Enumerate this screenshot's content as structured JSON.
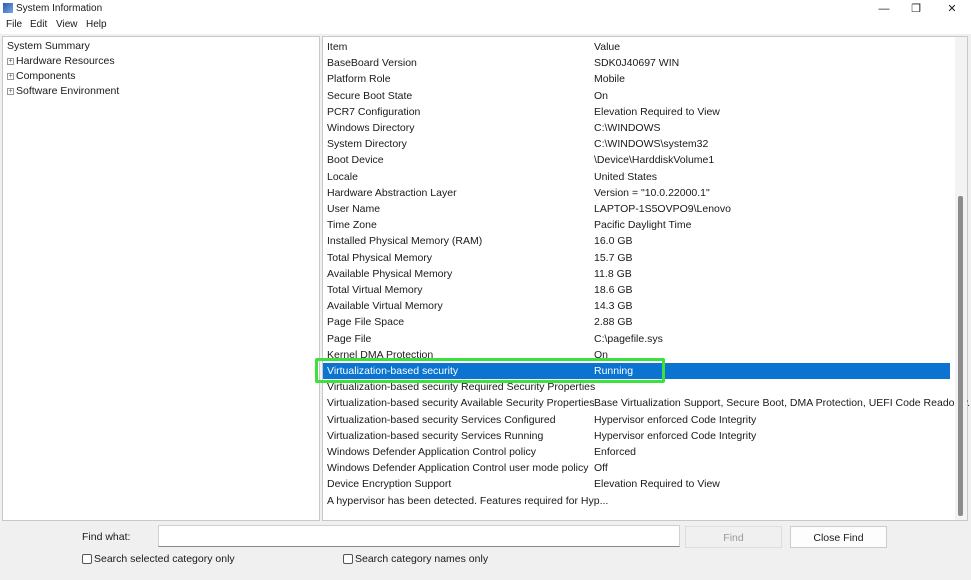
{
  "window": {
    "title": "System Information",
    "minimize": "—",
    "restore": "❐",
    "close": "✕"
  },
  "menu": [
    "File",
    "Edit",
    "View",
    "Help"
  ],
  "tree": {
    "root": "System Summary",
    "children": [
      "Hardware Resources",
      "Components",
      "Software Environment"
    ],
    "expand_glyph": "+"
  },
  "table": {
    "headers": [
      "Item",
      "Value"
    ],
    "rows": [
      [
        "BaseBoard Version",
        "SDK0J40697 WIN"
      ],
      [
        "Platform Role",
        "Mobile"
      ],
      [
        "Secure Boot State",
        "On"
      ],
      [
        "PCR7 Configuration",
        "Elevation Required to View"
      ],
      [
        "Windows Directory",
        "C:\\WINDOWS"
      ],
      [
        "System Directory",
        "C:\\WINDOWS\\system32"
      ],
      [
        "Boot Device",
        "\\Device\\HarddiskVolume1"
      ],
      [
        "Locale",
        "United States"
      ],
      [
        "Hardware Abstraction Layer",
        "Version = \"10.0.22000.1\""
      ],
      [
        "User Name",
        "LAPTOP-1S5OVPO9\\Lenovo"
      ],
      [
        "Time Zone",
        "Pacific Daylight Time"
      ],
      [
        "Installed Physical Memory (RAM)",
        "16.0 GB"
      ],
      [
        "Total Physical Memory",
        "15.7 GB"
      ],
      [
        "Available Physical Memory",
        "11.8 GB"
      ],
      [
        "Total Virtual Memory",
        "18.6 GB"
      ],
      [
        "Available Virtual Memory",
        "14.3 GB"
      ],
      [
        "Page File Space",
        "2.88 GB"
      ],
      [
        "Page File",
        "C:\\pagefile.sys"
      ],
      [
        "Kernel DMA Protection",
        "On"
      ],
      [
        "Virtualization-based security",
        "Running"
      ],
      [
        "Virtualization-based security Required Security Properties",
        ""
      ],
      [
        "Virtualization-based security Available Security Properties",
        "Base Virtualization Support, Secure Boot, DMA Protection, UEFI Code Readonly..."
      ],
      [
        "Virtualization-based security Services Configured",
        "Hypervisor enforced Code Integrity"
      ],
      [
        "Virtualization-based security Services Running",
        "Hypervisor enforced Code Integrity"
      ],
      [
        "Windows Defender Application Control policy",
        "Enforced"
      ],
      [
        "Windows Defender Application Control user mode policy",
        "Off"
      ],
      [
        "Device Encryption Support",
        "Elevation Required to View"
      ],
      [
        "A hypervisor has been detected. Features required for Hyp...",
        ""
      ]
    ],
    "selected_index": 19,
    "scroll_fraction": 0.33
  },
  "find": {
    "label": "Find what:",
    "value": "",
    "find_button": "Find",
    "close_button": "Close Find",
    "checkbox1": "Search selected category only",
    "checkbox2": "Search category names only"
  },
  "colors": {
    "selection": "#0a74d0",
    "highlight_box": "#3ee03e"
  }
}
